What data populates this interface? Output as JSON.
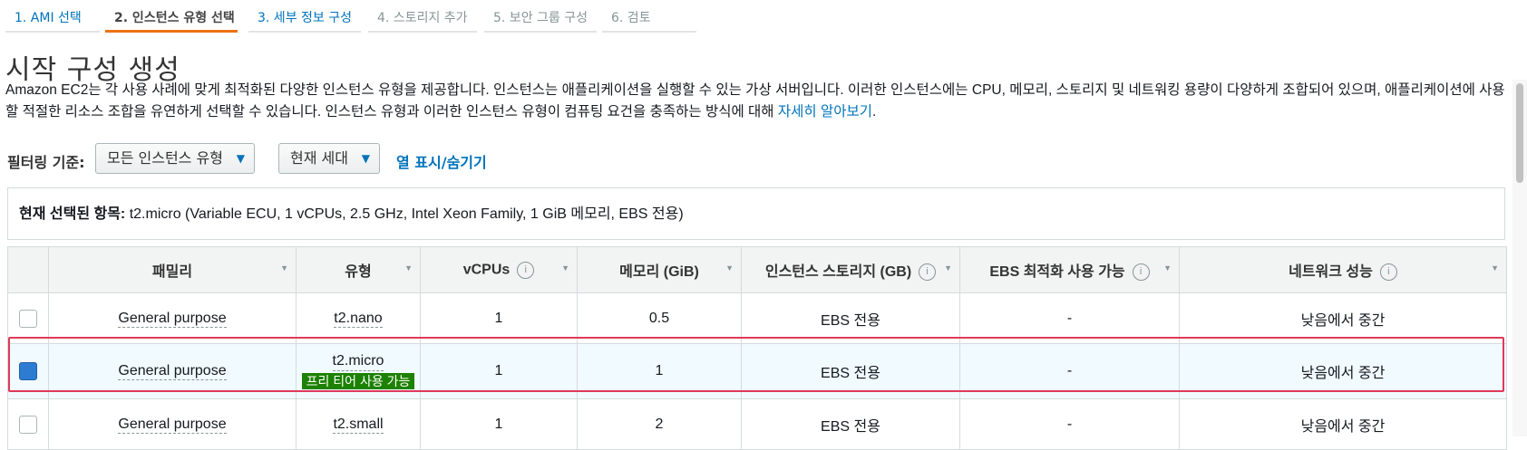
{
  "wizard": {
    "steps": [
      {
        "label": "1. AMI 선택"
      },
      {
        "label": "2. 인스턴스 유형 선택"
      },
      {
        "label": "3. 세부 정보 구성"
      },
      {
        "label": "4. 스토리지 추가"
      },
      {
        "label": "5. 보안 그룹 구성"
      },
      {
        "label": "6. 검토"
      }
    ]
  },
  "page": {
    "title": "시작 구성 생성",
    "description": "Amazon EC2는 각 사용 사례에 맞게 최적화된 다양한 인스턴스 유형을 제공합니다. 인스턴스는 애플리케이션을 실행할 수 있는 가상 서버입니다. 이러한 인스턴스에는 CPU, 메모리, 스토리지 및 네트워킹 용량이 다양하게 조합되어 있으며, 애플리케이션에 사용할 적절한 리소스 조합을 유연하게 선택할 수 있습니다. 인스턴스 유형과 이러한 인스턴스 유형이 컴퓨팅 요건을 충족하는 방식에 대해 ",
    "learn_more": "자세히 알아보기",
    "period": "."
  },
  "filter": {
    "label": "필터링 기준:",
    "family_select": "모든 인스턴스 유형",
    "generation_select": "현재 세대",
    "column_toggle": "열 표시/숨기기"
  },
  "selection": {
    "label": "현재 선택된 항목:",
    "value": " t2.micro (Variable ECU, 1 vCPUs, 2.5 GHz, Intel Xeon Family, 1 GiB 메모리, EBS 전용)"
  },
  "table": {
    "headers": {
      "family": "패밀리",
      "type": "유형",
      "vcpus": "vCPUs",
      "memory": "메모리 (GiB)",
      "storage": "인스턴스 스토리지 (GB)",
      "ebs": "EBS 최적화 사용 가능",
      "network": "네트워크 성능"
    },
    "rows": [
      {
        "family": "General purpose",
        "type": "t2.nano",
        "vcpus": "1",
        "memory": "0.5",
        "storage": "EBS 전용",
        "ebs": "-",
        "network": "낮음에서 중간",
        "checked": false
      },
      {
        "family": "General purpose",
        "type": "t2.micro",
        "badge": "프리 티어 사용 가능",
        "vcpus": "1",
        "memory": "1",
        "storage": "EBS 전용",
        "ebs": "-",
        "network": "낮음에서 중간",
        "checked": true
      },
      {
        "family": "General purpose",
        "type": "t2.small",
        "vcpus": "1",
        "memory": "2",
        "storage": "EBS 전용",
        "ebs": "-",
        "network": "낮음에서 중간",
        "checked": false
      }
    ]
  },
  "colors": {
    "accent": "#0073bb",
    "active_tab": "#ec7211",
    "badge": "#1d8102",
    "selected_outline": "#e0395a"
  }
}
